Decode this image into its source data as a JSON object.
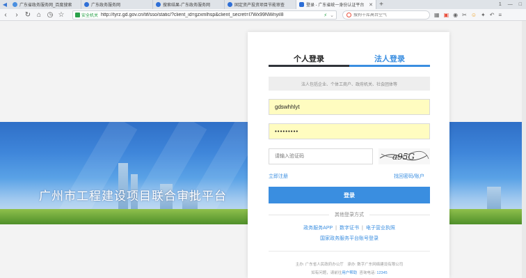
{
  "browser": {
    "tabs": [
      {
        "title": "广东省政务服务网_百度搜索",
        "active": false
      },
      {
        "title": "广东政务服务网",
        "active": false
      },
      {
        "title": "搜索结果-广东政务服务网",
        "active": false
      },
      {
        "title": "固定资产投资项目节能审查",
        "active": false
      },
      {
        "title": "登录 - 广东省统一身份认证平台",
        "active": true
      }
    ],
    "window_controls": [
      "1",
      "—",
      "□"
    ],
    "security_label": "安全机关",
    "url": "http://tyrz.gd.gov.cn/tif/sso/static/?client_id=gzxmlhsp&client_secret=I7Wx99NWnyiI8",
    "search_placeholder": "搜狗千库高台空气"
  },
  "banner": {
    "title": "广州市工程建设项目联合审批平台"
  },
  "login": {
    "tab_user": "个人登录",
    "tab_corp": "法人登录",
    "hint": "法人包括企业、个体工商户、政府机关、社会团体等",
    "username_value": "gdswhhlyt",
    "password_value": "•••••••••",
    "captcha_placeholder": "请输入验证码",
    "captcha_text": "a95G",
    "register_link": "立即注册",
    "find_link": "找回密码/账户",
    "login_button": "登录",
    "other_title": "其他登录方式",
    "other_links": [
      "政务服务APP",
      "数字证书",
      "电子营业执照"
    ],
    "other_link_national": "国家政务服务平台账号登录",
    "footer_line1": "主办: 广东省人民政府办公厅　承办: 数字广东网络建设有限公司",
    "footer_line2_prefix": "如有问题，请前往",
    "footer_help": "用户帮助",
    "footer_tel_label": "咨询电话:",
    "footer_tel": "12345"
  }
}
